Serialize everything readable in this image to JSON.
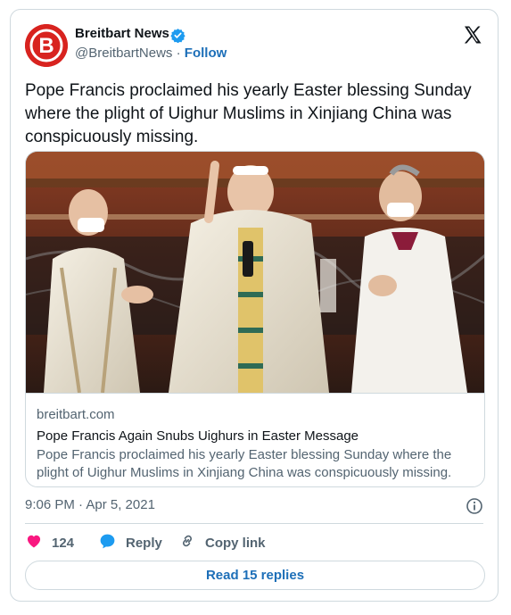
{
  "author": {
    "name": "Breitbart News",
    "handle": "@BreitbartNews",
    "separator": " · ",
    "follow_label": "Follow",
    "avatar_letter": "B"
  },
  "tweet": {
    "text": "Pope Francis proclaimed his yearly Easter blessing Sunday where the plight of Uighur Muslims in Xinjiang China was conspicuously missing."
  },
  "link_card": {
    "domain": "breitbart.com",
    "title": "Pope Francis Again Snubs Uighurs in Easter Message",
    "description": "Pope Francis proclaimed his yearly Easter blessing Sunday where the plight of Uighur Muslims in Xinjiang China was conspicuously missing."
  },
  "timestamp": "9:06 PM · Apr 5, 2021",
  "actions": {
    "likes_count": "124",
    "reply_label": "Reply",
    "copy_label": "Copy link"
  },
  "read_replies_label": "Read 15 replies",
  "colors": {
    "brand_red": "#d8231f",
    "link_blue": "#1d6fb8",
    "like_pink": "#f91880",
    "muted": "#536471",
    "border": "#cfd9de"
  },
  "icons": [
    "verified-badge-icon",
    "x-logo-icon",
    "info-icon",
    "heart-icon",
    "reply-bubble-icon",
    "link-icon"
  ]
}
